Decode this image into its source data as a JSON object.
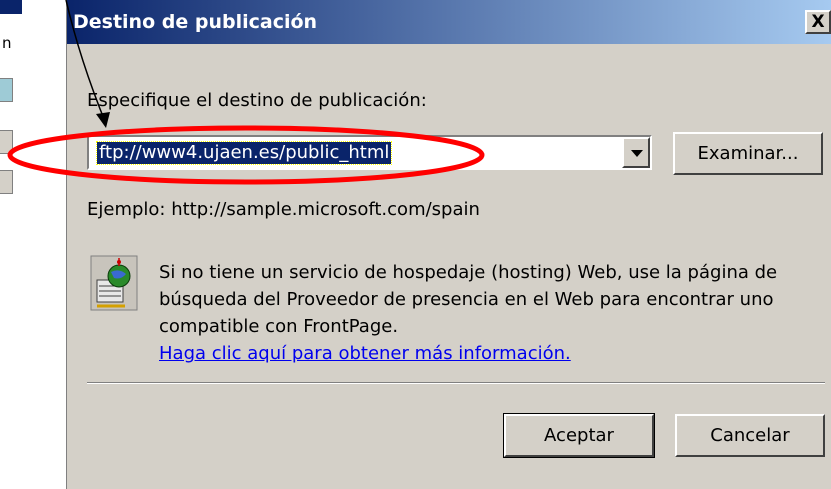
{
  "dialog": {
    "title": "Destino de publicación",
    "close_label": "X",
    "prompt_label": "Especifique el destino de publicación:",
    "destination_value": "ftp://www4.ujaen.es/public_html",
    "browse_label": "Examinar...",
    "example_text": "Ejemplo: http://sample.microsoft.com/spain",
    "info_text": "Si no tiene un servicio de hospedaje (hosting) Web, use la página de búsqueda del Proveedor de presencia en el Web para encontrar uno compatible con FrontPage.",
    "info_link": "Haga clic aquí para obtener más información.",
    "ok_label": "Aceptar",
    "cancel_label": "Cancelar"
  },
  "background_window": {
    "visible_text": "n"
  },
  "colors": {
    "titlebar_start": "#0a246a",
    "titlebar_end": "#a6caf0",
    "dialog_bg": "#d4d0c8",
    "selection_bg": "#0a246a",
    "link": "#0000ee",
    "annotation_ellipse": "#ff0000"
  },
  "icons": {
    "close": "close-icon",
    "dropdown": "chevron-down-icon",
    "info": "web-server-globe-icon"
  }
}
